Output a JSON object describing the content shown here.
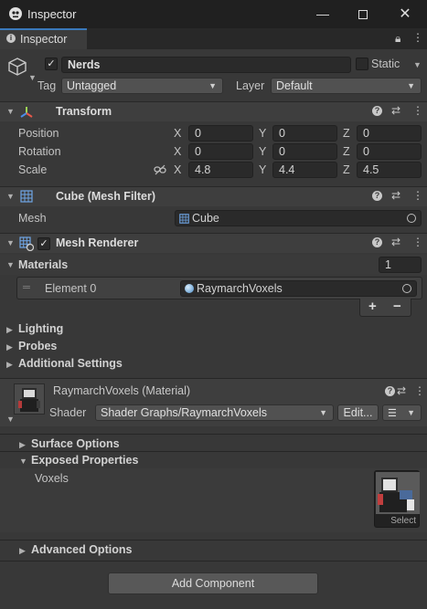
{
  "window": {
    "title": "Inspector"
  },
  "tab": {
    "label": "Inspector"
  },
  "object": {
    "name": "Nerds",
    "static_label": "Static",
    "tag_label": "Tag",
    "tag_value": "Untagged",
    "layer_label": "Layer",
    "layer_value": "Default"
  },
  "transform": {
    "title": "Transform",
    "position": {
      "label": "Position",
      "x": "0",
      "y": "0",
      "z": "0"
    },
    "rotation": {
      "label": "Rotation",
      "x": "0",
      "y": "0",
      "z": "0"
    },
    "scale": {
      "label": "Scale",
      "x": "4.8",
      "y": "4.4",
      "z": "4.5"
    },
    "axes": {
      "x": "X",
      "y": "Y",
      "z": "Z"
    }
  },
  "mesh_filter": {
    "title": "Cube (Mesh Filter)",
    "mesh_label": "Mesh",
    "mesh_value": "Cube"
  },
  "mesh_renderer": {
    "title": "Mesh Renderer",
    "materials_label": "Materials",
    "materials_count": "1",
    "element_label": "Element 0",
    "element_value": "RaymarchVoxels",
    "add": "+",
    "remove": "−",
    "lighting": "Lighting",
    "probes": "Probes",
    "additional": "Additional Settings"
  },
  "material": {
    "title": "RaymarchVoxels (Material)",
    "shader_label": "Shader",
    "shader_value": "Shader Graphs/RaymarchVoxels",
    "edit_label": "Edit...",
    "surface": "Surface Options",
    "exposed": "Exposed Properties",
    "voxels_label": "Voxels",
    "select_label": "Select",
    "advanced": "Advanced Options"
  },
  "footer": {
    "add_component": "Add Component"
  },
  "colors": {
    "accent": "#3a79bb",
    "panel": "#383838",
    "header": "#3e3e3e"
  }
}
